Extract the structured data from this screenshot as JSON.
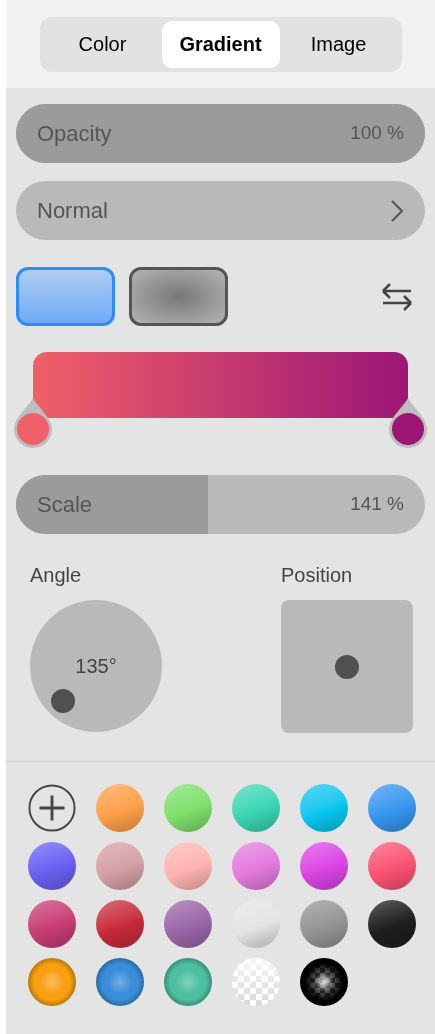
{
  "tabs": [
    {
      "label": "Color",
      "selected": false
    },
    {
      "label": "Gradient",
      "selected": true
    },
    {
      "label": "Image",
      "selected": false
    }
  ],
  "opacity": {
    "label": "Opacity",
    "reading": "100 %",
    "level": 1
  },
  "blend_mode": {
    "value": "Normal"
  },
  "gradient_types": [
    {
      "kind": "linear",
      "selected": true
    },
    {
      "kind": "radial",
      "selected": false
    }
  ],
  "gradient_stops": [
    {
      "color": "#f06068"
    },
    {
      "color": "#9c1676"
    }
  ],
  "scale": {
    "label": "Scale",
    "reading": "141 %",
    "level": 0.47
  },
  "angle": {
    "label": "Angle",
    "reading": "135°"
  },
  "position": {
    "label": "Position"
  },
  "presets": [
    {
      "kind": "add"
    },
    {
      "kind": "linear",
      "color": "#ffa048"
    },
    {
      "kind": "linear",
      "color": "#7ee06a"
    },
    {
      "kind": "linear",
      "color": "#3ad6b4"
    },
    {
      "kind": "linear",
      "color": "#08c6f0"
    },
    {
      "kind": "linear",
      "color": "#3696f0"
    },
    {
      "kind": "linear",
      "color": "#6a60f2"
    },
    {
      "kind": "linear",
      "color": "#d4a0a6"
    },
    {
      "kind": "linear",
      "color": "#ffb4b0"
    },
    {
      "kind": "linear",
      "color": "#e47ade"
    },
    {
      "kind": "linear",
      "color": "#dc44e4"
    },
    {
      "kind": "linear",
      "color": "#fa5272"
    },
    {
      "kind": "linear",
      "color": "#c83c74"
    },
    {
      "kind": "linear",
      "color": "#c82a3a"
    },
    {
      "kind": "linear",
      "color": "#9a66a8"
    },
    {
      "kind": "linear",
      "color": "#e4e4e4"
    },
    {
      "kind": "linear",
      "color": "#949494"
    },
    {
      "kind": "linear",
      "color": "#1e1e1e"
    },
    {
      "kind": "radial",
      "color": "#f8a010"
    },
    {
      "kind": "radial",
      "color": "#3a8ed8"
    },
    {
      "kind": "radial",
      "color": "#4cc0a0"
    },
    {
      "kind": "checker",
      "color": "#ffffff"
    },
    {
      "kind": "checker-radial",
      "color": "#000000"
    }
  ]
}
